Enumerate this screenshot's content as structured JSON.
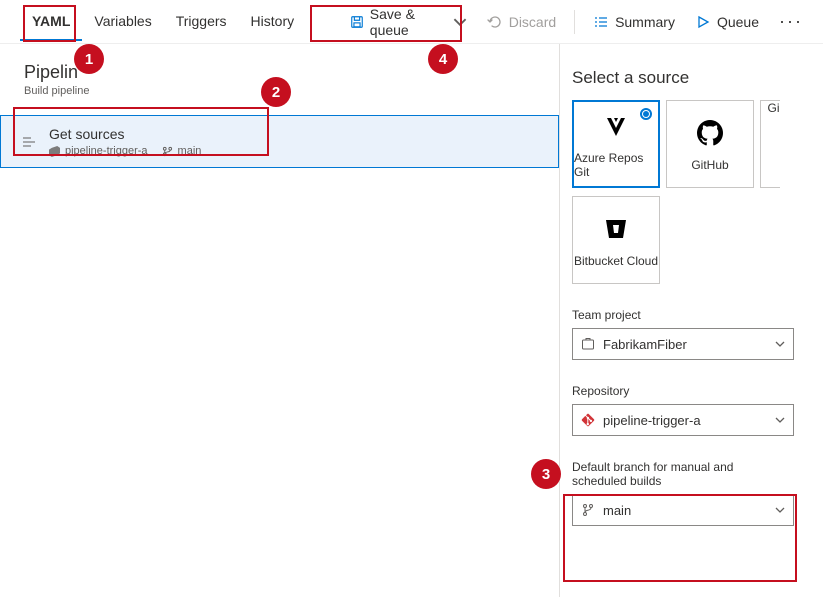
{
  "tabs": {
    "yaml": "YAML",
    "variables": "Variables",
    "triggers": "Triggers",
    "history": "History"
  },
  "toolbar": {
    "save_queue": "Save & queue",
    "discard": "Discard",
    "summary": "Summary",
    "queue": "Queue"
  },
  "pipeline": {
    "title_visible": "Pipelin",
    "subtitle": "Build pipeline"
  },
  "get_sources": {
    "title": "Get sources",
    "repo": "pipeline-trigger-a",
    "branch": "main"
  },
  "right": {
    "title": "Select a source",
    "sources": {
      "azure": "Azure Repos Git",
      "github": "GitHub",
      "gi_partial": "Gi",
      "bitbucket": "Bitbucket Cloud"
    },
    "team_project_label": "Team project",
    "team_project_value": "FabrikamFiber",
    "repo_label": "Repository",
    "repo_value": "pipeline-trigger-a",
    "branch_label": "Default branch for manual and scheduled builds",
    "branch_value": "main"
  },
  "callouts": {
    "n1": "1",
    "n2": "2",
    "n3": "3",
    "n4": "4"
  }
}
